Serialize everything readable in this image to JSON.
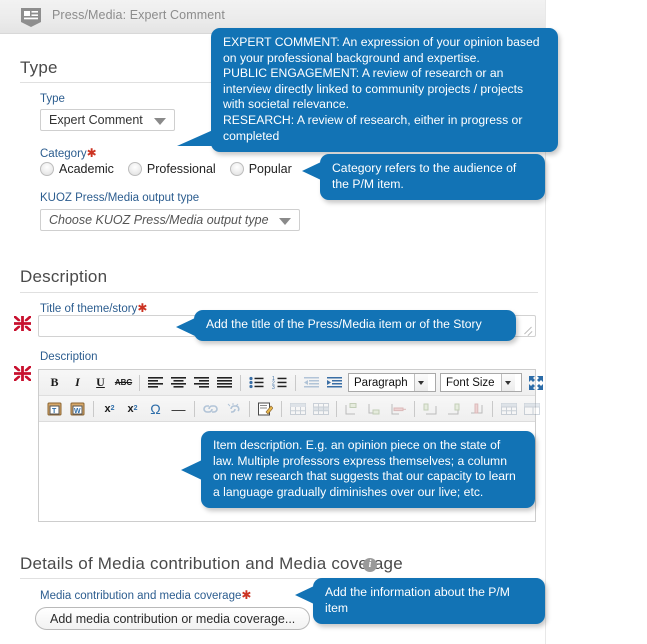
{
  "window": {
    "title": "Press/Media: Expert Comment",
    "icon": "press-media-icon"
  },
  "sections": {
    "type": {
      "heading": "Type",
      "type_label": "Type",
      "type_value": "Expert Comment",
      "category_label": "Category",
      "category_required": "✱",
      "category_options": [
        "Academic",
        "Professional",
        "Popular"
      ],
      "kuoz_label": "KUOZ Press/Media output type",
      "kuoz_placeholder": "Choose KUOZ Press/Media output type"
    },
    "description": {
      "heading": "Description",
      "title_label": "Title of theme/story",
      "title_required": "✱",
      "title_value": "",
      "description_label": "Description",
      "editor_value": ""
    },
    "details": {
      "heading": "Details of Media contribution and Media coverage",
      "info_icon": "i",
      "field_label": "Media contribution and media coverage",
      "field_required": "✱",
      "add_button": "Add media contribution or media coverage..."
    }
  },
  "editor_toolbar": {
    "row1": [
      {
        "name": "bold-icon",
        "glyph": "B"
      },
      {
        "name": "italic-icon",
        "glyph": "I"
      },
      {
        "name": "underline-icon",
        "glyph": "U"
      },
      {
        "name": "strikethrough-icon",
        "glyph": "ABC"
      },
      {
        "name": "align-left-icon",
        "glyph": ""
      },
      {
        "name": "align-center-icon",
        "glyph": ""
      },
      {
        "name": "align-right-icon",
        "glyph": ""
      },
      {
        "name": "align-justify-icon",
        "glyph": ""
      },
      {
        "name": "bullet-list-icon",
        "glyph": ""
      },
      {
        "name": "numbered-list-icon",
        "glyph": ""
      },
      {
        "name": "outdent-icon",
        "glyph": ""
      },
      {
        "name": "indent-icon",
        "glyph": ""
      }
    ],
    "paragraph_select": "Paragraph",
    "fontsize_select": "Font Size",
    "fullscreen_icon": "fullscreen-icon",
    "row2": [
      {
        "name": "paste-as-text-icon",
        "glyph": "T"
      },
      {
        "name": "paste-from-word-icon",
        "glyph": "W"
      },
      {
        "name": "subscript-icon",
        "glyph": "x₂"
      },
      {
        "name": "superscript-icon",
        "glyph": "x²"
      },
      {
        "name": "special-character-icon",
        "glyph": "Ω"
      },
      {
        "name": "horizontal-rule-icon",
        "glyph": "—"
      },
      {
        "name": "insert-link-icon",
        "glyph": ""
      },
      {
        "name": "unlink-icon",
        "glyph": ""
      },
      {
        "name": "edit-source-icon",
        "glyph": ""
      },
      {
        "name": "insert-table-icon",
        "glyph": ""
      },
      {
        "name": "table-row-props-icon",
        "glyph": ""
      },
      {
        "name": "table-cell-props-icon",
        "glyph": ""
      },
      {
        "name": "insert-row-before-icon",
        "glyph": ""
      },
      {
        "name": "insert-row-after-icon",
        "glyph": ""
      },
      {
        "name": "delete-row-icon",
        "glyph": ""
      },
      {
        "name": "insert-column-before-icon",
        "glyph": ""
      },
      {
        "name": "insert-column-after-icon",
        "glyph": ""
      },
      {
        "name": "delete-column-icon",
        "glyph": ""
      },
      {
        "name": "split-cell-icon",
        "glyph": ""
      },
      {
        "name": "merge-cell-icon",
        "glyph": ""
      }
    ]
  },
  "callouts": {
    "type": "EXPERT COMMENT: An expression of your opinion based on your professional background and expertise.\nPUBLIC ENGAGEMENT: A review of research or an interview directly linked to community projects / projects with societal relevance.\nRESEARCH: A review of research, either in progress or completed",
    "category": "Category refers to the audience of the P/M item.",
    "title": "Add the title of the Press/Media item or of the Story",
    "description": "Item description. E.g. an opinion piece on the state of law. Multiple professors express themselves; a column on new research that suggests that our capacity to learn a language gradually diminishes over our live; etc.",
    "details": "Add the information about the P/M item"
  },
  "colors": {
    "callout_blue": "#1273b5",
    "label_blue": "#2c5d8f",
    "required_red": "#cc3322",
    "heading_gray": "#4a4a4a",
    "titlebar_gray": "#8c8c8c"
  },
  "locale_flag": "uk-flag-icon"
}
